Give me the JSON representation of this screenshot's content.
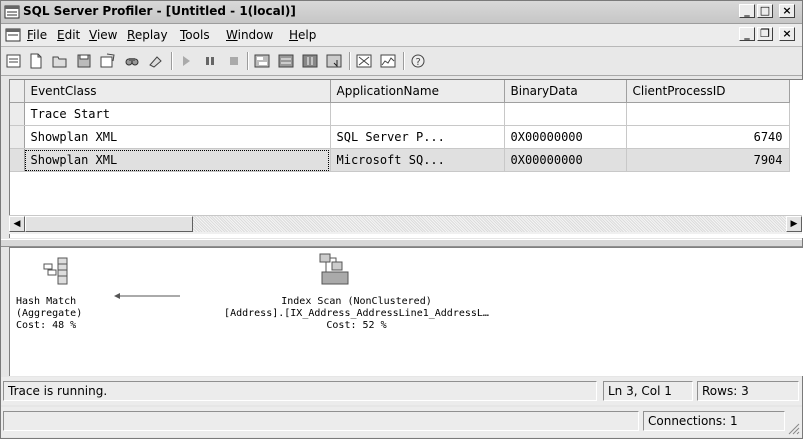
{
  "window": {
    "title": "SQL Server Profiler - [Untitled - 1(local)]",
    "title_buttons": [
      "_",
      "□",
      "×"
    ]
  },
  "menu": {
    "items": [
      {
        "label": "File",
        "accel": "F",
        "rest": "ile"
      },
      {
        "label": "Edit",
        "accel": "E",
        "rest": "dit"
      },
      {
        "label": "View",
        "accel": "V",
        "rest": "iew"
      },
      {
        "label": "Replay",
        "accel": "R",
        "rest": "eplay"
      },
      {
        "label": "Tools",
        "accel": "T",
        "rest": "ools"
      },
      {
        "label": "Window",
        "accel": "W",
        "rest": "indow"
      },
      {
        "label": "Help",
        "accel": "H",
        "rest": "elp"
      }
    ],
    "mdi_buttons": [
      "_",
      "❐",
      "×"
    ]
  },
  "toolbar": {
    "icons": [
      "properties-icon",
      "new-trace-icon",
      "open-icon",
      "save-icon",
      "template-icon",
      "find-icon",
      "clear-icon",
      "play-icon",
      "pause-icon",
      "stop-icon",
      "group-icon",
      "list-icon",
      "columns-icon",
      "autoscroll-icon",
      "tuning-icon",
      "perfmon-icon",
      "help-icon"
    ]
  },
  "grid": {
    "columns": [
      "EventClass",
      "ApplicationName",
      "BinaryData",
      "ClientProcessID"
    ],
    "rows": [
      {
        "event_class": "Trace Start",
        "application_name": "",
        "binary_data": "",
        "client_process_id": ""
      },
      {
        "event_class": "Showplan XML",
        "application_name": "SQL Server P...",
        "binary_data": "0X00000000",
        "client_process_id": "6740"
      },
      {
        "event_class": "Showplan XML",
        "application_name": "Microsoft SQ...",
        "binary_data": "0X00000000",
        "client_process_id": "7904"
      }
    ]
  },
  "plan": {
    "hash_match": {
      "line1": "Hash Match",
      "line2": "(Aggregate)",
      "line3": "Cost: 48 %"
    },
    "index_scan": {
      "line1": "Index Scan (NonClustered)",
      "line2": "[Address].[IX_Address_AddressLine1_AddressL…",
      "line3": "Cost: 52 %"
    }
  },
  "status": {
    "message": "Trace is running.",
    "position": "Ln 3, Col 1",
    "rows": "Rows: 3",
    "connections": "Connections: 1"
  }
}
